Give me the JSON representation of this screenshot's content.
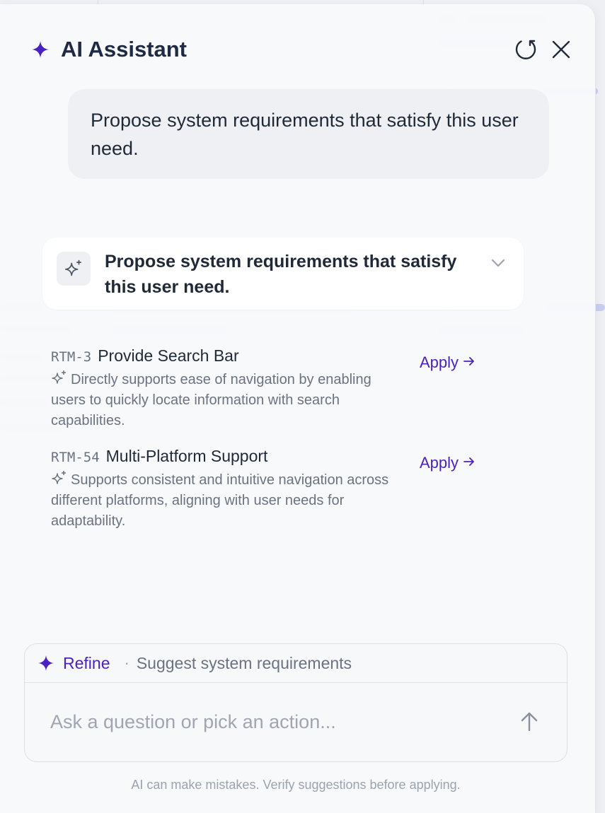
{
  "assistant": {
    "title": "AI Assistant",
    "icons": {
      "logo": "sparkle-icon",
      "refresh": "refresh-icon",
      "close": "close-icon"
    },
    "accent_color": "#4a22c4"
  },
  "user_message": "Propose system requirements that satisfy this user need.",
  "result": {
    "title": "Propose system requirements that satisfy this user need.",
    "icon": "ai-sparkles-icon",
    "expand_icon": "chevron-down-icon"
  },
  "suggestions": [
    {
      "id": "RTM-3",
      "title": "Provide Search Bar",
      "description": "Directly supports ease of navigation by enabling users to quickly locate information with search capabilities.",
      "apply_label": "Apply"
    },
    {
      "id": "RTM-54",
      "title": "Multi-Platform Support",
      "description": "Supports consistent and intuitive navigation across different platforms, aligning with user needs for adaptability.",
      "apply_label": "Apply"
    }
  ],
  "composer": {
    "context_action": "Refine",
    "context_text": "Suggest system requirements",
    "placeholder": "Ask a question or pick an action..."
  },
  "disclaimer": "AI can make mistakes. Verify suggestions before applying."
}
